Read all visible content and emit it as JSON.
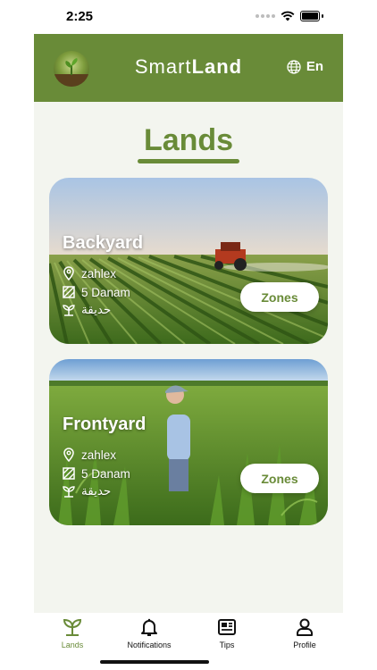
{
  "status_bar": {
    "time": "2:25"
  },
  "header": {
    "title_light": "Smart",
    "title_bold": "Land",
    "language": "En"
  },
  "page": {
    "title": "Lands"
  },
  "lands": [
    {
      "name": "Backyard",
      "location": "zahlex",
      "area": "5 Danam",
      "type": "حديقة",
      "zones_label": "Zones"
    },
    {
      "name": "Frontyard",
      "location": "zahlex",
      "area": "5 Danam",
      "type": "حديقة",
      "zones_label": "Zones"
    }
  ],
  "tabbar": {
    "items": [
      {
        "label": "Lands",
        "icon": "plant-icon",
        "active": true
      },
      {
        "label": "Notifications",
        "icon": "bell-icon",
        "active": false
      },
      {
        "label": "Tips",
        "icon": "newspaper-icon",
        "active": false
      },
      {
        "label": "Profile",
        "icon": "person-icon",
        "active": false
      }
    ]
  },
  "colors": {
    "brand": "#698b38",
    "background": "#f3f5ef"
  }
}
